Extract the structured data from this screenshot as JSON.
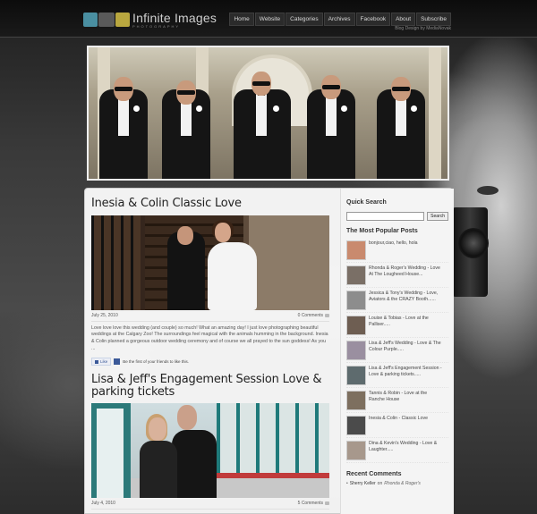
{
  "header": {
    "logo_title": "Infinite Images",
    "logo_subtitle": "PHOTOGRAPHY",
    "nav": [
      "Home",
      "Website",
      "Categories",
      "Archives",
      "Facebook",
      "About",
      "Subscribe"
    ],
    "credit": "Blog Design by MediaNovak"
  },
  "posts": [
    {
      "title": "Inesia & Colin  Classic Love",
      "date": "July 25, 2010",
      "comments": "0 Comments",
      "excerpt": "Love love love this wedding (and couple) so much! What an amazing day! I just love photographing beautiful weddings at the Calgary Zoo! The surroundings feel magical with the animals humming in the background.  Inesia & Colin planned a gorgeous outdoor wedding ceremony and of course we all prayed to the sun goddess!  As you ...",
      "like_label": "Like",
      "like_text": "Be the first of your friends to like this."
    },
    {
      "title": "Lisa & Jeff's Engagement Session  Love & parking tickets",
      "date": "July 4, 2010",
      "comments": "5 Comments"
    }
  ],
  "sidebar": {
    "search_heading": "Quick Search",
    "search_value": "",
    "search_button": "Search",
    "popular_heading": "The Most Popular Posts",
    "popular": [
      "bonjour,ciao, hello, hola",
      "Rhonda & Roger's Wedding - Love At The Lougheed House...",
      "Jessica & Tony's Wedding - Love, Aviators & the CRAZY Booth......",
      "Louise & Tobias - Love at the Palliser.....",
      "Lisa & Jeff's Wedding - Love & The Colour Purple.....",
      "Lisa & Jeff's Engagement Session - Love & parking tickets.....",
      "Tannis & Robin - Love at the Ranche House",
      "Inesia & Colin - Classic Love",
      "Dina & Kevin's Wedding - Love & Laughter....."
    ],
    "recent_heading": "Recent Comments",
    "recent": [
      {
        "author": "Sherry Keller",
        "on": "on",
        "post": "Rhonda & Roger's"
      }
    ]
  },
  "colors": {
    "thumbs": [
      "#c98a6e",
      "#7a6f66",
      "#8d8d8d",
      "#6e5e52",
      "#9a8fa0",
      "#5e6b6e",
      "#7d6f5f",
      "#4b4b4b",
      "#a7988c"
    ]
  }
}
